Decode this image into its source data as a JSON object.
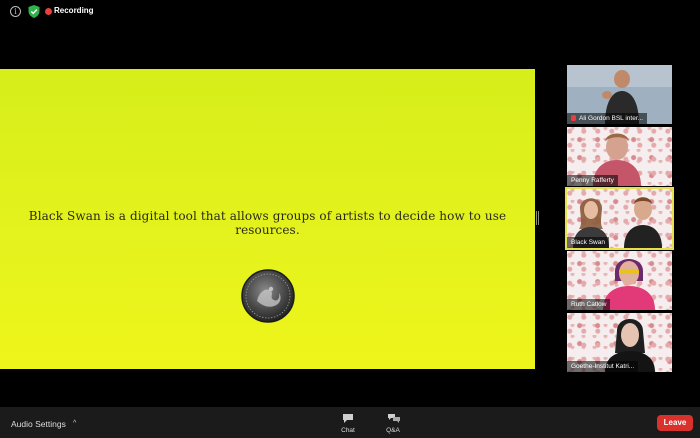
{
  "status": {
    "recording_label": "Recording"
  },
  "slide": {
    "text": "Black Swan is a digital tool that allows groups of artists to decide how to use resources."
  },
  "participants": [
    {
      "name": "Ali Gordon BSL inter...",
      "muted": true
    },
    {
      "name": "Penny Rafferty",
      "muted": false
    },
    {
      "name": "Black Swan",
      "muted": false,
      "active": true
    },
    {
      "name": "Ruth Catlow",
      "muted": false
    },
    {
      "name": "Goethe-Institut Katri...",
      "muted": false
    }
  ],
  "toolbar": {
    "audio_settings_label": "Audio Settings",
    "chat_label": "Chat",
    "qa_label": "Q&A",
    "leave_label": "Leave"
  },
  "colors": {
    "slide_background": "#e2f21c",
    "recording": "#e8413c",
    "leave": "#d9322c",
    "active_speaker": "#e6e14a"
  }
}
